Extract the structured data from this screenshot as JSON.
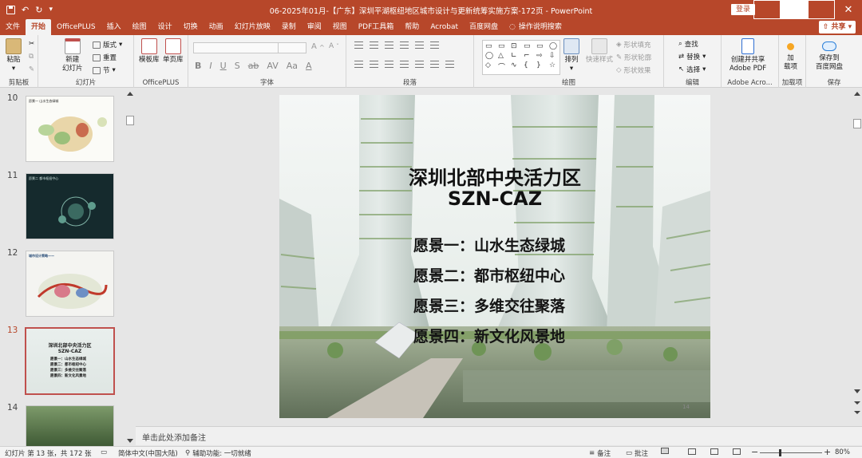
{
  "titlebar": {
    "title": "06-2025年01月-【广东】深圳平湖枢纽地区城市设计与更新统筹实施方案-172页  -  PowerPoint",
    "login": "登录"
  },
  "tabs": [
    "文件",
    "开始",
    "OfficePLUS",
    "插入",
    "绘图",
    "设计",
    "切换",
    "动画",
    "幻灯片放映",
    "录制",
    "审阅",
    "视图",
    "PDF工具箱",
    "帮助",
    "Acrobat",
    "百度网盘"
  ],
  "tell_me": "操作说明搜索",
  "share": "共享",
  "ribbon": {
    "clipboard": {
      "paste": "粘贴",
      "label": "剪贴板"
    },
    "slides": {
      "new_slide": "新建\n幻灯片",
      "layout": "版式",
      "reset": "重置",
      "section": "节",
      "label": "幻灯片"
    },
    "officeplus": {
      "template": "模板库",
      "single": "单页库",
      "label": "OfficePLUS"
    },
    "font": {
      "label": "字体"
    },
    "paragraph": {
      "label": "段落"
    },
    "drawing": {
      "arrange": "排列",
      "quick_styles": "快速样式",
      "fill": "形状填充",
      "outline": "形状轮廓",
      "effects": "形状效果",
      "label": "绘图"
    },
    "editing": {
      "find": "查找",
      "replace": "替换",
      "select": "选择",
      "label": "编辑"
    },
    "adobe": {
      "create": "创建并共享\nAdobe PDF",
      "label": "Adobe Acro..."
    },
    "addins": {
      "addins": "加\n载项",
      "label": "加载项"
    },
    "save": {
      "save_baidu": "保存到\n百度网盘",
      "label": "保存"
    }
  },
  "thumbnails": [
    {
      "num": "10",
      "title": "愿景一  山水生态绿城"
    },
    {
      "num": "11",
      "title": "愿景二 都市枢纽中心"
    },
    {
      "num": "12",
      "title": "城市设计策略——"
    },
    {
      "num": "13",
      "title": "深圳北部中央活力区",
      "subtitle": "SZN-CAZ",
      "lines": [
        "愿景一：山水生态绿城",
        "愿景二：都市枢纽中心",
        "愿景三：多维交往聚落",
        "愿景四：新文化风景地"
      ]
    },
    {
      "num": "14",
      "title": ""
    }
  ],
  "slide": {
    "title": "深圳北部中央活力区",
    "subtitle": "SZN-CAZ",
    "visions": [
      "愿景一：山水生态绿城",
      "愿景二：都市枢纽中心",
      "愿景三：多维交往聚落",
      "愿景四：新文化风景地"
    ],
    "page_no": "14"
  },
  "notes_placeholder": "单击此处添加备注",
  "statusbar": {
    "slide_count": "幻灯片 第 13 张，共 172 张",
    "language": "简体中文(中国大陆)",
    "accessibility": "辅助功能: 一切就绪",
    "notes": "备注",
    "comments": "批注",
    "zoom": "80%"
  },
  "colors": {
    "accent": "#b7472a",
    "thumb_active_border": "#c0504d"
  }
}
